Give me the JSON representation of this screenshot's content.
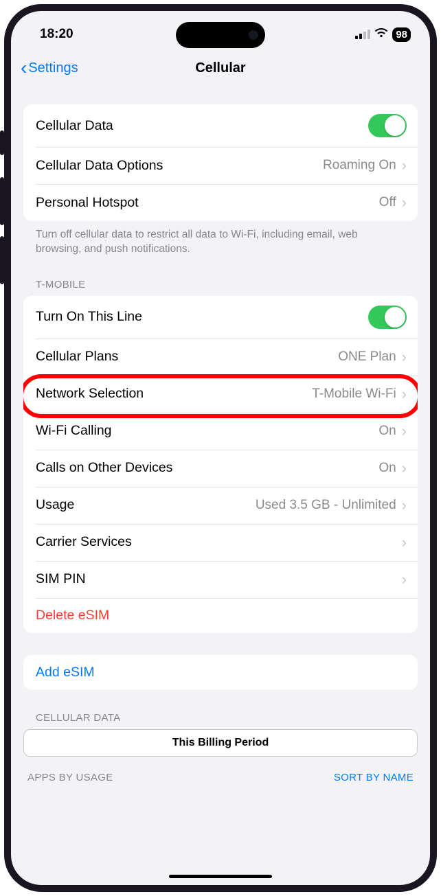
{
  "status": {
    "time": "18:20",
    "battery": "98"
  },
  "nav": {
    "back": "Settings",
    "title": "Cellular"
  },
  "group1": {
    "cellular_data": "Cellular Data",
    "data_options": {
      "label": "Cellular Data Options",
      "value": "Roaming On"
    },
    "hotspot": {
      "label": "Personal Hotspot",
      "value": "Off"
    },
    "footer": "Turn off cellular data to restrict all data to Wi-Fi, including email, web browsing, and push notifications."
  },
  "carrier_header": "T-MOBILE",
  "group2": {
    "turn_on": "Turn On This Line",
    "plans": {
      "label": "Cellular Plans",
      "value": "ONE Plan"
    },
    "network": {
      "label": "Network Selection",
      "value": "T-Mobile Wi-Fi"
    },
    "wifi_calling": {
      "label": "Wi-Fi Calling",
      "value": "On"
    },
    "other_devices": {
      "label": "Calls on Other Devices",
      "value": "On"
    },
    "usage": {
      "label": "Usage",
      "value": "Used 3.5 GB - Unlimited"
    },
    "carrier_services": "Carrier Services",
    "sim_pin": "SIM PIN",
    "delete_esim": "Delete eSIM"
  },
  "group3": {
    "add_esim": "Add eSIM"
  },
  "data_section": {
    "header": "CELLULAR DATA",
    "segment": "This Billing Period",
    "apps_by_usage": "APPS BY USAGE",
    "sort_by_name": "SORT BY NAME"
  }
}
